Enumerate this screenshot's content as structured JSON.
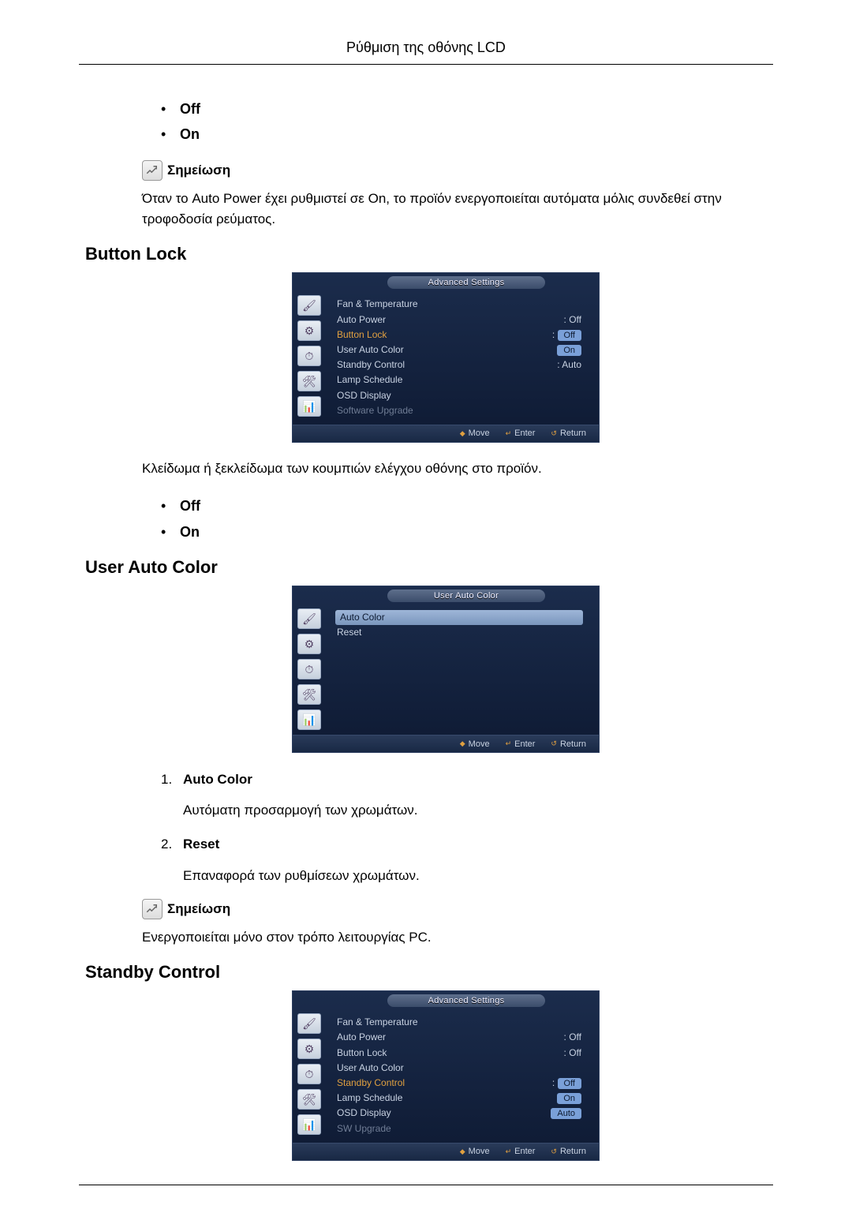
{
  "page_header": "Ρύθμιση της οθόνης LCD",
  "intro_options": [
    "Off",
    "On"
  ],
  "note_label": "Σημείωση",
  "intro_note_text": "Όταν το Auto Power έχει ρυθμιστεί σε On, το προϊόν ενεργοποιείται αυτόματα μόλις συνδεθεί στην τροφοδοσία ρεύματος.",
  "sections": {
    "button_lock": {
      "heading": "Button Lock",
      "desc": "Κλείδωμα ή ξεκλείδωμα των κουμπιών ελέγχου οθόνης στο προϊόν.",
      "options": [
        "Off",
        "On"
      ]
    },
    "user_auto_color": {
      "heading": "User Auto Color",
      "items": [
        {
          "title": "Auto Color",
          "desc": "Αυτόματη προσαρμογή των χρωμάτων."
        },
        {
          "title": "Reset",
          "desc": "Επαναφορά των ρυθμίσεων χρωμάτων."
        }
      ],
      "note_text": "Ενεργοποιείται μόνο στον τρόπο λειτουργίας PC."
    },
    "standby_control": {
      "heading": "Standby Control"
    }
  },
  "osd_footer": {
    "move": "Move",
    "enter": "Enter",
    "return": "Return"
  },
  "osd1": {
    "title": "Advanced Settings",
    "rows": [
      {
        "label": "Fan & Temperature",
        "value": ""
      },
      {
        "label": "Auto Power",
        "value": ": Off"
      },
      {
        "label": "Button Lock",
        "value_chip": "Off",
        "hl": true,
        "colon": ":"
      },
      {
        "label": "User Auto Color",
        "value_chip": "On"
      },
      {
        "label": "Standby Control",
        "value": ": Auto"
      },
      {
        "label": "Lamp Schedule",
        "value": ""
      },
      {
        "label": "OSD Display",
        "value": ""
      },
      {
        "label": "Software Upgrade",
        "value": "",
        "dim": true
      }
    ]
  },
  "osd2": {
    "title": "User Auto Color",
    "rows": [
      {
        "label": "Auto Color",
        "selected": true
      },
      {
        "label": "Reset"
      }
    ]
  },
  "osd3": {
    "title": "Advanced Settings",
    "rows": [
      {
        "label": "Fan & Temperature",
        "value": ""
      },
      {
        "label": "Auto Power",
        "value": ": Off"
      },
      {
        "label": "Button Lock",
        "value": ": Off"
      },
      {
        "label": "User Auto Color",
        "value": ""
      },
      {
        "label": "Standby Control",
        "value_chip": "Off",
        "hl": true,
        "colon": ":"
      },
      {
        "label": "Lamp Schedule",
        "value_chip": "On"
      },
      {
        "label": "OSD Display",
        "value_chip": "Auto"
      },
      {
        "label": "SW Upgrade",
        "value": "",
        "dim": true
      }
    ]
  }
}
